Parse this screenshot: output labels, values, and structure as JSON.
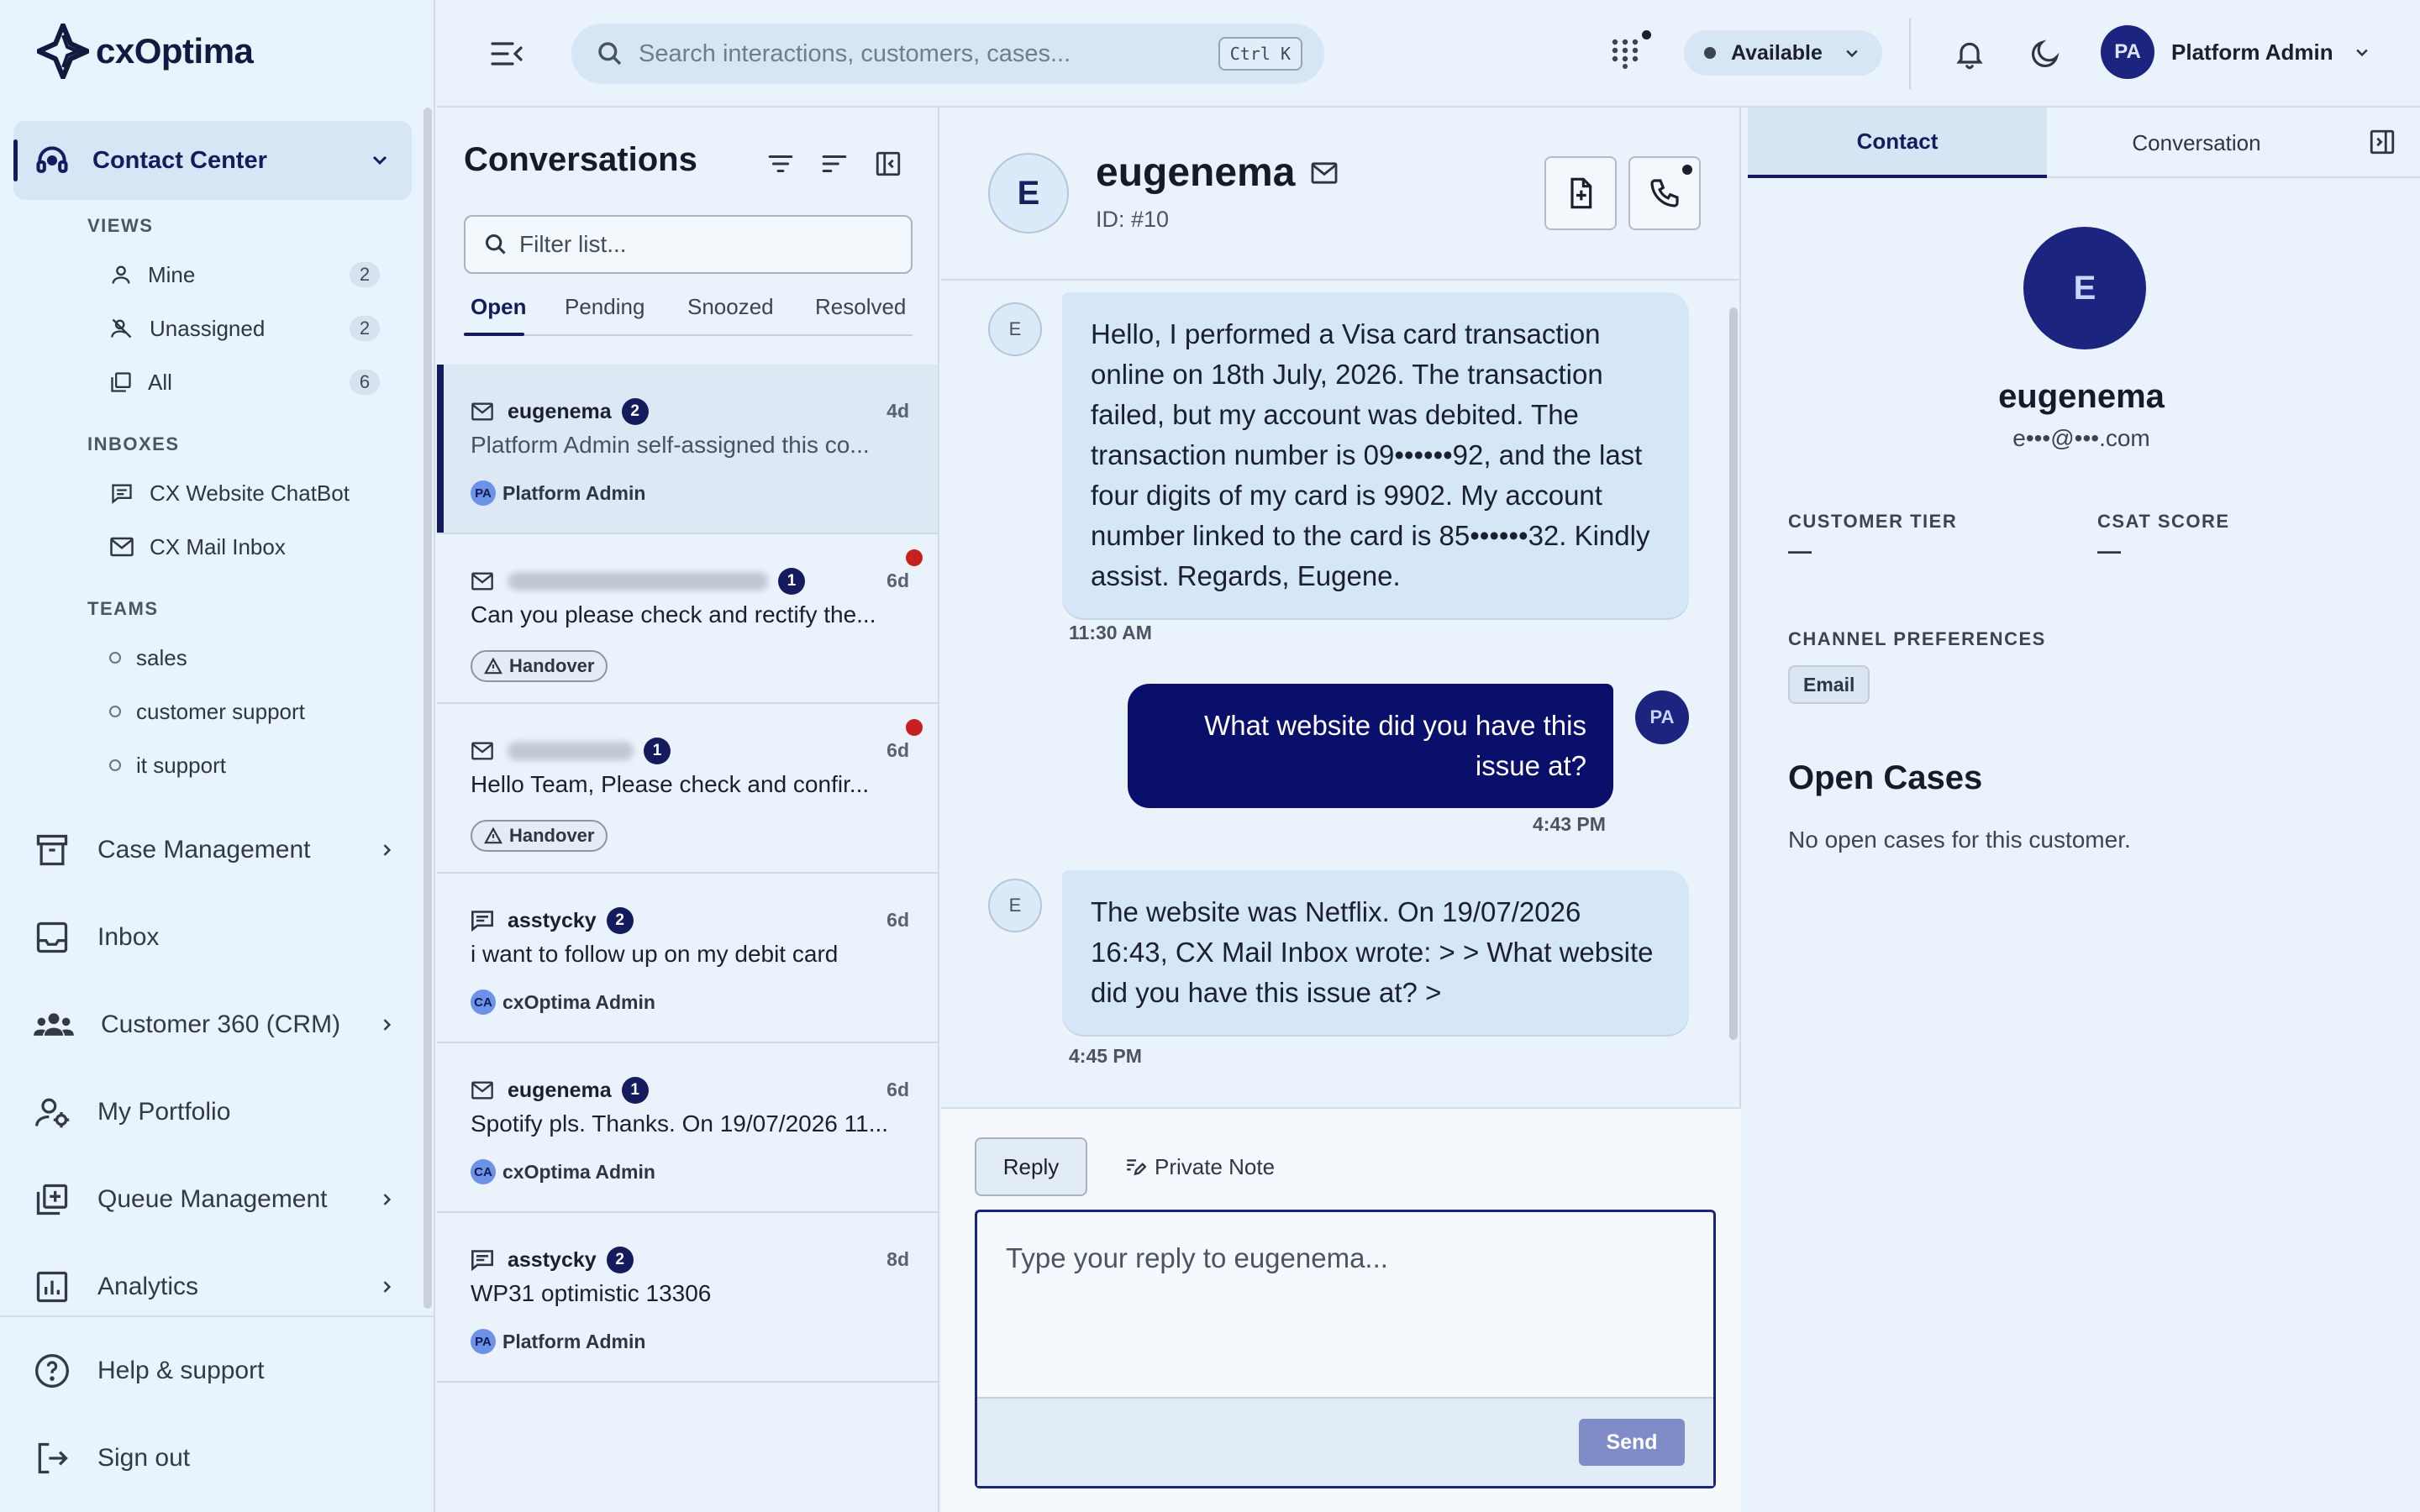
{
  "brand": {
    "name": "cxOptima"
  },
  "sidebar": {
    "contact_center": "Contact Center",
    "views_heading": "VIEWS",
    "views": [
      {
        "label": "Mine",
        "count": "2"
      },
      {
        "label": "Unassigned",
        "count": "2"
      },
      {
        "label": "All",
        "count": "6"
      }
    ],
    "inboxes_heading": "INBOXES",
    "inboxes": [
      {
        "label": "CX Website ChatBot"
      },
      {
        "label": "CX Mail Inbox"
      }
    ],
    "teams_heading": "TEAMS",
    "teams": [
      {
        "label": "sales"
      },
      {
        "label": "customer support"
      },
      {
        "label": "it support"
      }
    ],
    "nav": [
      {
        "label": "Case Management",
        "icon": "archive-icon"
      },
      {
        "label": "Inbox",
        "icon": "inbox-icon"
      },
      {
        "label": "Customer 360 (CRM)",
        "icon": "users-icon"
      },
      {
        "label": "My Portfolio",
        "icon": "user-settings-icon"
      },
      {
        "label": "Queue Management",
        "icon": "queue-add-icon"
      },
      {
        "label": "Analytics",
        "icon": "chart-icon"
      }
    ],
    "help": "Help & support",
    "signout": "Sign out"
  },
  "topbar": {
    "search_placeholder": "Search interactions, customers, cases...",
    "shortcut": "Ctrl K",
    "status": "Available",
    "user_initials": "PA",
    "user_name": "Platform Admin"
  },
  "conversations": {
    "title": "Conversations",
    "filter_placeholder": "Filter list...",
    "tabs": [
      "Open",
      "Pending",
      "Snoozed",
      "Resolved"
    ],
    "items": [
      {
        "channel": "mail-icon",
        "name": "eugenema",
        "badge": "2",
        "time": "4d",
        "preview": "Platform Admin self-assigned this co...",
        "agent_initials": "PA",
        "agent": "Platform Admin",
        "selected": true
      },
      {
        "channel": "mail-icon",
        "name": "",
        "badge": "1",
        "time": "6d",
        "preview": "Can you please check and rectify the...",
        "tag": "Handover",
        "unread": true
      },
      {
        "channel": "mail-icon",
        "name": "",
        "badge": "1",
        "time": "6d",
        "preview": "Hello Team, Please check and confir...",
        "tag": "Handover",
        "unread": true
      },
      {
        "channel": "chat-icon",
        "name": "asstycky",
        "badge": "2",
        "time": "6d",
        "preview": "i want to follow up on my debit card",
        "agent_initials": "CA",
        "agent": "cxOptima Admin"
      },
      {
        "channel": "mail-icon",
        "name": "eugenema",
        "badge": "1",
        "time": "6d",
        "preview": "Spotify pls. Thanks. On 19/07/2026 11...",
        "agent_initials": "CA",
        "agent": "cxOptima Admin"
      },
      {
        "channel": "chat-icon",
        "name": "asstycky",
        "badge": "2",
        "time": "8d",
        "preview": "WP31 optimistic 13306",
        "agent_initials": "PA",
        "agent": "Platform Admin"
      }
    ]
  },
  "chat": {
    "avatar": "E",
    "name": "eugenema",
    "id": "ID: #10",
    "messages": [
      {
        "from": "customer",
        "avatar": "E",
        "text": "Hello, I performed a Visa card transaction online on 18th July, 2026. The transaction failed, but my account was debited. The transaction number is 09••••••92, and the last four digits of my card is 9902. My account number linked to the card is 85••••••32. Kindly assist. Regards, Eugene.",
        "time": "11:30 AM"
      },
      {
        "from": "agent",
        "avatar": "PA",
        "text": "What website did you have this issue at?",
        "time": "4:43 PM"
      },
      {
        "from": "customer",
        "avatar": "E",
        "text": "The website was Netflix. On 19/07/2026 16:43, CX Mail Inbox wrote: > > What website did you have this issue at? >",
        "time": "4:45 PM"
      }
    ],
    "reply_tab": "Reply",
    "note_tab": "Private Note",
    "reply_placeholder": "Type your reply to eugenema...",
    "send": "Send"
  },
  "contact": {
    "tabs": [
      "Contact",
      "Conversation"
    ],
    "avatar": "E",
    "name": "eugenema",
    "email": "e•••@•••.com",
    "tier_label": "CUSTOMER TIER",
    "tier_value": "—",
    "csat_label": "CSAT SCORE",
    "csat_value": "—",
    "channel_pref_label": "CHANNEL PREFERENCES",
    "channel_pref": "Email",
    "open_cases_title": "Open Cases",
    "open_cases_empty": "No open cases for this customer."
  },
  "colors": {
    "accent": "#141c5e",
    "avatar": "#1b2580",
    "unread": "#c5221f",
    "sidebar_bg": "#e8f3fd"
  }
}
